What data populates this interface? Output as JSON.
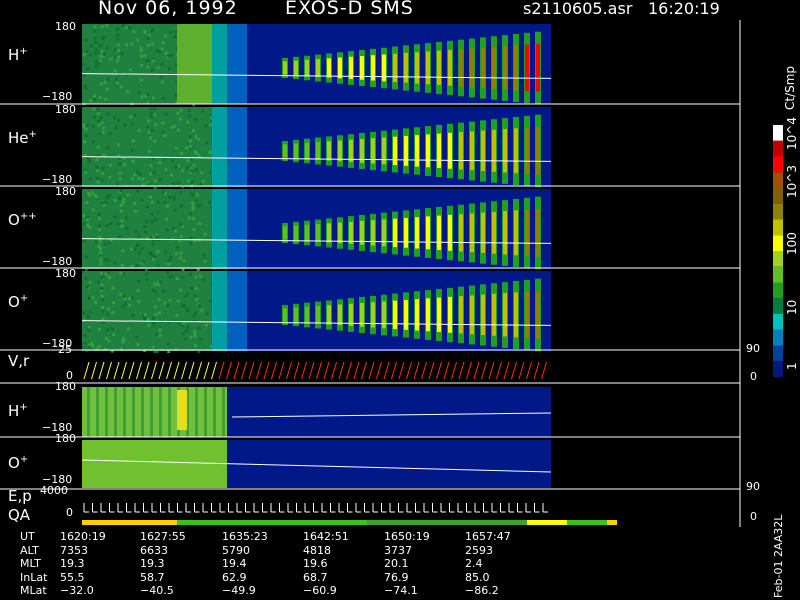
{
  "header": {
    "date": "Nov 06, 1992",
    "instrument": "EXOS-D SMS",
    "file": "s2110605.asr",
    "time": "16:20:19"
  },
  "colorbar": {
    "unit_label": "Ct/Smp",
    "tick_labels": [
      "10^4",
      "10^3",
      "100",
      "10",
      "1"
    ],
    "colors": [
      "#ffffff",
      "#c00000",
      "#ff0000",
      "#a05000",
      "#806000",
      "#908000",
      "#c0c000",
      "#ffff00",
      "#a0d020",
      "#60c020",
      "#20a020",
      "#008040",
      "#00c0c0",
      "#0080c0",
      "#0040a0",
      "#001880"
    ]
  },
  "panels": [
    {
      "label": "H",
      "sup": "+",
      "ytop": "180",
      "ybot": "−180"
    },
    {
      "label": "He",
      "sup": "+",
      "ytop": "180",
      "ybot": "−180"
    },
    {
      "label": "O",
      "sup": "++",
      "ytop": "180",
      "ybot": "−180"
    },
    {
      "label": "O",
      "sup": "+",
      "ytop": "180",
      "ybot": "−180"
    }
  ],
  "vr_panel": {
    "label": "V,r",
    "ytop": "25",
    "ybot": "0",
    "rtop": "90",
    "rbot": "0"
  },
  "lower_panels": [
    {
      "label": "H",
      "sup": "+",
      "ytop": "180",
      "ybot": "−180"
    },
    {
      "label": "O",
      "sup": "+",
      "ytop": "180",
      "ybot": "−180"
    }
  ],
  "ep_panel": {
    "label1": "E,p",
    "label2": "QA",
    "ytop": "4000",
    "ybot": "0",
    "rtop": "90",
    "rbot": "0"
  },
  "footer": {
    "rows": [
      {
        "name": "UT",
        "values": [
          "1620:19",
          "1627:55",
          "1635:23",
          "1642:51",
          "1650:19",
          "1657:47"
        ]
      },
      {
        "name": "ALT",
        "values": [
          "7353",
          "6633",
          "5790",
          "4818",
          "3737",
          "2593"
        ]
      },
      {
        "name": "MLT",
        "values": [
          "19.3",
          "19.3",
          "19.4",
          "19.6",
          "20.1",
          "2.4"
        ]
      },
      {
        "name": "InLat",
        "values": [
          "55.5",
          "58.7",
          "62.9",
          "68.7",
          "76.9",
          "85.0"
        ]
      },
      {
        "name": "MLat",
        "values": [
          "−32.0",
          "−40.5",
          "−49.9",
          "−60.9",
          "−74.1",
          "−86.2"
        ]
      }
    ],
    "side_label": "Feb-01 2AA32L"
  },
  "chart_data": {
    "type": "heatmap",
    "title": "Nov 06, 1992   EXOS-D SMS",
    "x_tick_labels_UT": [
      "1620:19",
      "1627:55",
      "1635:23",
      "1642:51",
      "1650:19",
      "1657:47"
    ],
    "panels": [
      "H+",
      "He+",
      "O++",
      "O+",
      "V,r",
      "H+",
      "O+",
      "E,p QA"
    ],
    "ylim_angle": [
      -180,
      180
    ],
    "ylim_V": [
      0,
      25
    ],
    "ylim_E": [
      0,
      4000
    ],
    "ylim_right": [
      0,
      90
    ],
    "colorbar_unit": "Ct/Smp",
    "colorbar_ticks": [
      "1",
      "10",
      "100",
      "10^3",
      "10^4"
    ]
  }
}
